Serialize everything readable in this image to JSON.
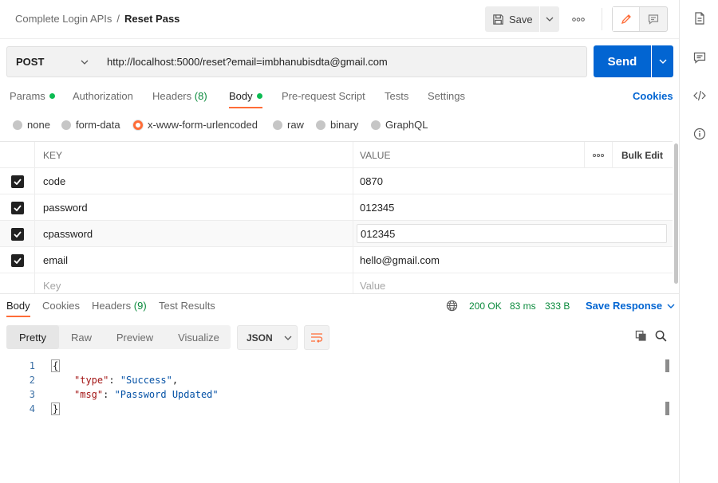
{
  "breadcrumb": {
    "parent": "Complete Login APIs",
    "separator": "/",
    "current": "Reset Pass"
  },
  "header": {
    "save_label": "Save"
  },
  "request": {
    "method": "POST",
    "url": "http://localhost:5000/reset?email=imbhanubisdta@gmail.com",
    "send_label": "Send"
  },
  "tabs": {
    "params": "Params",
    "authorization": "Authorization",
    "headers": "Headers",
    "headers_count": "(8)",
    "body": "Body",
    "pre_request": "Pre-request Script",
    "tests": "Tests",
    "settings": "Settings",
    "cookies": "Cookies"
  },
  "body_types": [
    "none",
    "form-data",
    "x-www-form-urlencoded",
    "raw",
    "binary",
    "GraphQL"
  ],
  "body_type_selected": "x-www-form-urlencoded",
  "params_table": {
    "headers": {
      "key": "KEY",
      "value": "VALUE",
      "bulk_edit": "Bulk Edit"
    },
    "rows": [
      {
        "key": "code",
        "value": "0870",
        "checked": true
      },
      {
        "key": "password",
        "value": "012345",
        "checked": true
      },
      {
        "key": "cpassword",
        "value": "012345",
        "checked": true
      },
      {
        "key": "email",
        "value": "hello@gmail.com",
        "checked": true
      }
    ],
    "placeholder_key": "Key",
    "placeholder_value": "Value"
  },
  "response": {
    "tabs": {
      "body": "Body",
      "cookies": "Cookies",
      "headers": "Headers",
      "headers_count": "(9)",
      "test_results": "Test Results"
    },
    "status": "200 OK",
    "time": "83 ms",
    "size": "333 B",
    "save_response": "Save Response",
    "views": [
      "Pretty",
      "Raw",
      "Preview",
      "Visualize"
    ],
    "active_view": "Pretty",
    "format": "JSON",
    "code_lines": [
      {
        "n": "1",
        "open": "{"
      },
      {
        "n": "2",
        "key": "\"type\"",
        "val": "\"Success\"",
        "trail": ","
      },
      {
        "n": "3",
        "key": "\"msg\"",
        "val": "\"Password Updated\"",
        "trail": ""
      },
      {
        "n": "4",
        "close": "}"
      }
    ]
  },
  "colors": {
    "accent": "#ff6c37",
    "primary": "#0265d2",
    "success": "#0a8a3c"
  },
  "icons": [
    "save-icon",
    "chevron-down-icon",
    "more-icon",
    "pencil-icon",
    "comment-icon",
    "document-icon",
    "code-icon",
    "info-icon",
    "globe-icon",
    "copy-icon",
    "search-icon",
    "wrap-lines-icon",
    "checkmark-icon"
  ]
}
